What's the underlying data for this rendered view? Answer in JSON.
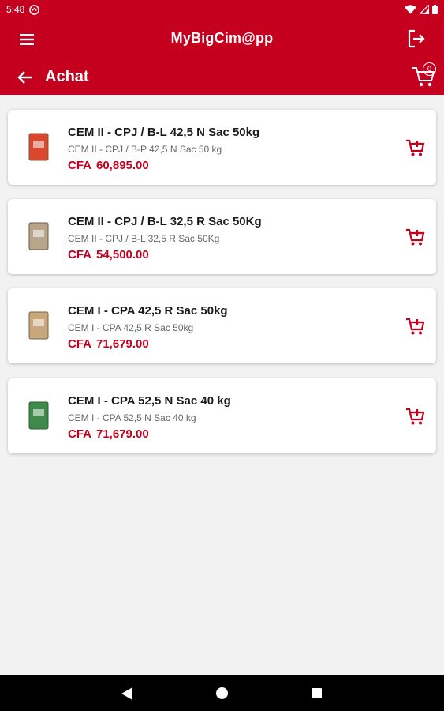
{
  "status_bar": {
    "time": "5:48"
  },
  "app_bar": {
    "title": "MyBigCim@pp",
    "page_title": "Achat",
    "cart_count": "0"
  },
  "colors": {
    "brand": "#c5001e",
    "background": "#f2f2f2",
    "price": "#c5001e"
  },
  "icons": [
    "menu-icon",
    "logout-icon",
    "back-arrow-icon",
    "cart-icon",
    "add-to-cart-icon",
    "product-bag-icon"
  ],
  "products": [
    {
      "name": "CEM II - CPJ / B-L 42,5 N Sac 50kg",
      "description": "CEM II - CPJ / B-P 42,5 N Sac 50 kg",
      "currency": "CFA",
      "price": "60,895.00",
      "bag_color": "#d8472e"
    },
    {
      "name": "CEM II - CPJ / B-L 32,5 R Sac 50Kg",
      "description": "CEM II - CPJ / B-L 32,5 R Sac 50Kg",
      "currency": "CFA",
      "price": "54,500.00",
      "bag_color": "#b9a58a"
    },
    {
      "name": "CEM I - CPA 42,5 R Sac 50kg",
      "description": "CEM I - CPA 42,5 R Sac 50kg",
      "currency": "CFA",
      "price": "71,679.00",
      "bag_color": "#c9a77c"
    },
    {
      "name": "CEM I - CPA 52,5 N Sac 40 kg",
      "description": "CEM I - CPA 52,5 N Sac 40 kg",
      "currency": "CFA",
      "price": "71,679.00",
      "bag_color": "#3f8a4a"
    }
  ]
}
